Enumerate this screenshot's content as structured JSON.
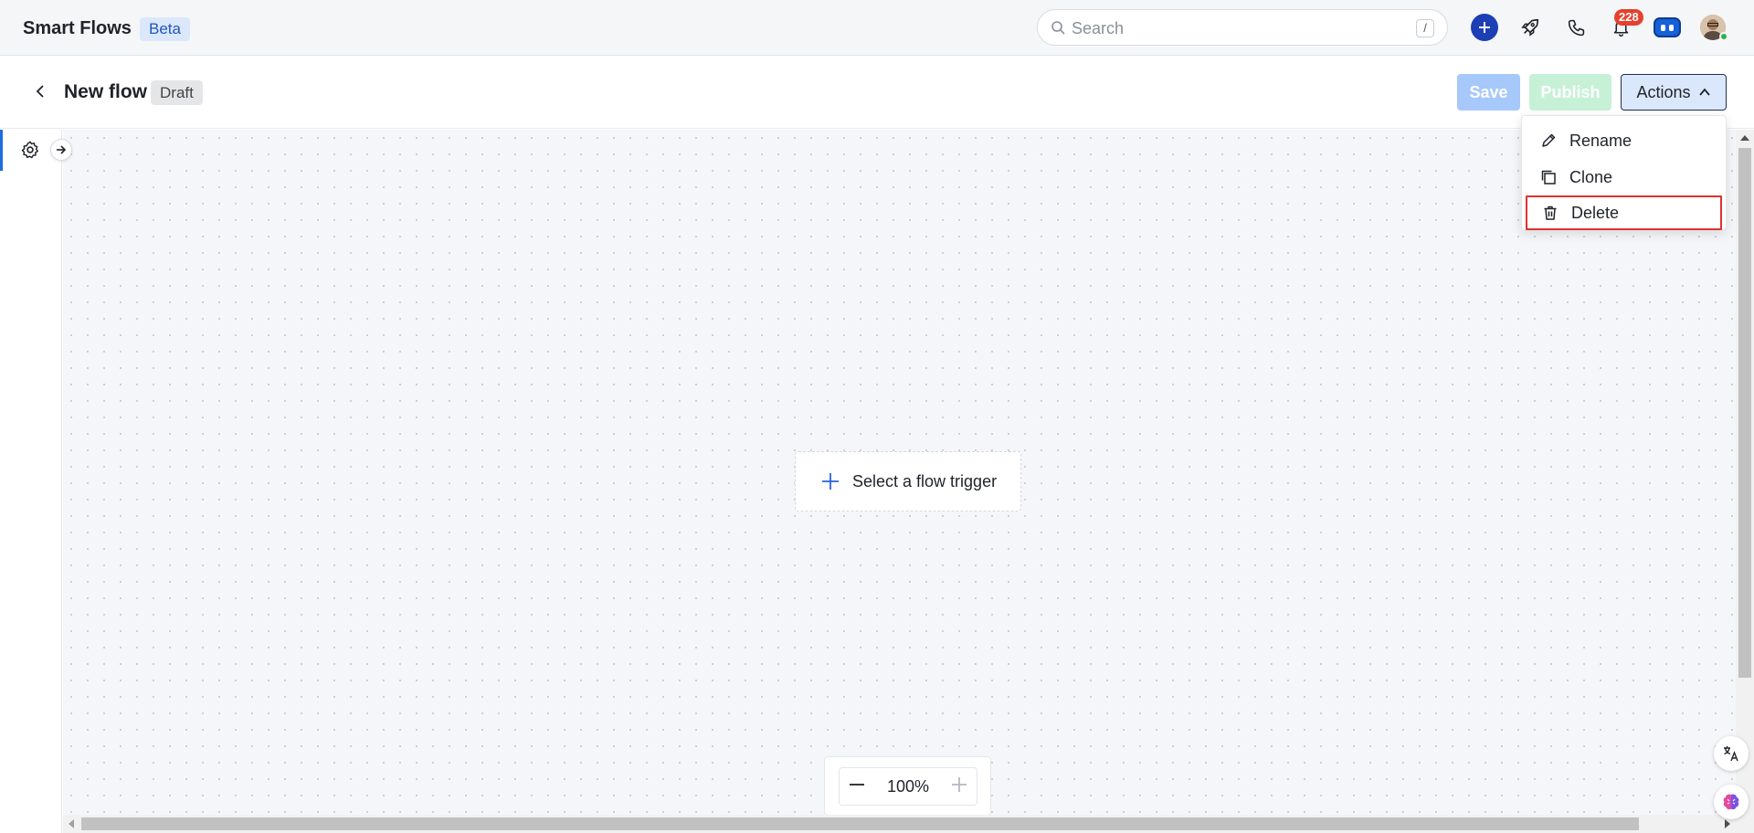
{
  "app": {
    "title": "Smart Flows",
    "badge": "Beta"
  },
  "search": {
    "placeholder": "Search",
    "shortcut": "/"
  },
  "notifications": {
    "count": "228"
  },
  "flow": {
    "title": "New flow",
    "status": "Draft"
  },
  "toolbar": {
    "save_label": "Save",
    "publish_label": "Publish",
    "actions_label": "Actions"
  },
  "actions_menu": {
    "items": [
      {
        "label": "Rename",
        "icon": "pencil-icon"
      },
      {
        "label": "Clone",
        "icon": "copy-icon"
      },
      {
        "label": "Delete",
        "icon": "trash-icon"
      }
    ]
  },
  "canvas": {
    "trigger_label": "Select a flow trigger"
  },
  "zoom": {
    "level": "100%"
  },
  "colors": {
    "accent": "#1d3fb5",
    "badge": "#e5412c",
    "highlight": "#e03131",
    "save_disabled": "#a6c8fa",
    "publish_disabled": "#c6f1d7"
  }
}
